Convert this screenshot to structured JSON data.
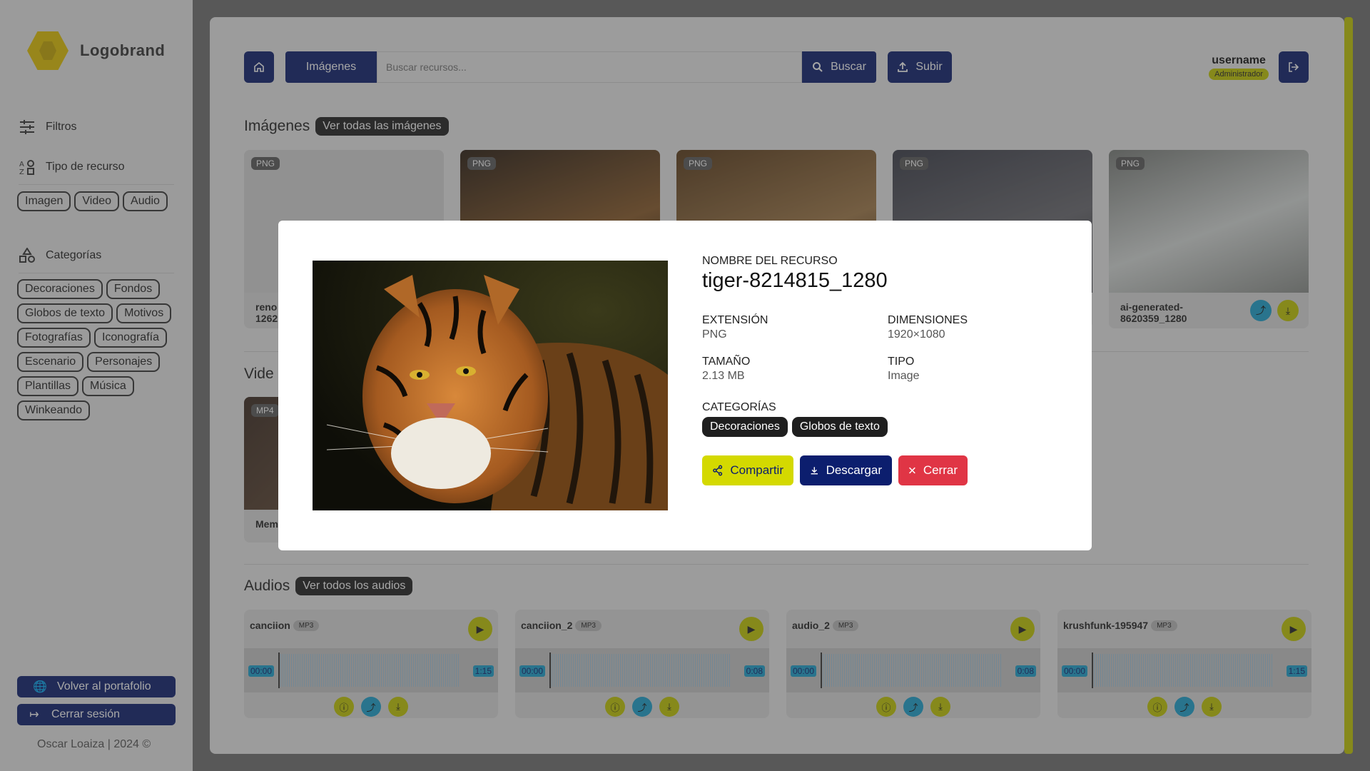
{
  "brand": {
    "name": "Logobrand"
  },
  "sidebar": {
    "filters_label": "Filtros",
    "type_label": "Tipo de recurso",
    "types": [
      "Imagen",
      "Video",
      "Audio"
    ],
    "categories_label": "Categorías",
    "categories": [
      "Decoraciones",
      "Fondos",
      "Globos de texto",
      "Motivos",
      "Fotografías",
      "Iconografía",
      "Escenario",
      "Personajes",
      "Plantillas",
      "Música",
      "Winkeando"
    ],
    "portfolio_button": "Volver al portafolio",
    "logout_button": "Cerrar sesión",
    "footer": "Oscar Loaiza | 2024 ©"
  },
  "topbar": {
    "tab_label": "Imágenes",
    "search_placeholder": "Buscar recursos...",
    "search_button": "Buscar",
    "upload_button": "Subir",
    "username": "username",
    "role": "Administrador"
  },
  "images_section": {
    "title": "Imágenes",
    "view_all": "Ver todas las imágenes",
    "cards": [
      {
        "format": "PNG",
        "name": "reno\n1262",
        "color": "#d8d8d8"
      },
      {
        "format": "PNG",
        "name": "",
        "color": "#3b2a18"
      },
      {
        "format": "PNG",
        "name": "",
        "color": "#6b4a28"
      },
      {
        "format": "PNG",
        "name": "",
        "color": "#4a4c58"
      },
      {
        "format": "PNG",
        "name": "ai-generated-8620359_1280",
        "color": "#9fa3a0"
      }
    ]
  },
  "videos_section": {
    "title": "Vide",
    "cards": [
      {
        "format": "MP4",
        "name": "Mem"
      }
    ]
  },
  "audios_section": {
    "title": "Audios",
    "view_all": "Ver todos los audios",
    "cards": [
      {
        "name": "canciion",
        "format": "MP3",
        "start": "00:00",
        "duration": "1:15"
      },
      {
        "name": "canciion_2",
        "format": "MP3",
        "start": "00:00",
        "duration": "0:08"
      },
      {
        "name": "audio_2",
        "format": "MP3",
        "start": "00:00",
        "duration": "0:08"
      },
      {
        "name": "krushfunk-195947",
        "format": "MP3",
        "start": "00:00",
        "duration": "1:15"
      }
    ]
  },
  "modal": {
    "name_label": "NOMBRE DEL RECURSO",
    "name": "tiger-8214815_1280",
    "extension_label": "EXTENSIÓN",
    "extension": "PNG",
    "dimensions_label": "DIMENSIONES",
    "dimensions": "1920×1080",
    "size_label": "TAMAÑO",
    "size": "2.13 MB",
    "type_label": "TIPO",
    "type": "Image",
    "categories_label": "CATEGORÍAS",
    "categories": [
      "Decoraciones",
      "Globos de texto"
    ],
    "share_button": "Compartir",
    "download_button": "Descargar",
    "close_button": "Cerrar"
  },
  "colors": {
    "primary": "#0c1e6e",
    "accent": "#c4c900",
    "info": "#1aa3cf",
    "danger": "#e03545"
  }
}
